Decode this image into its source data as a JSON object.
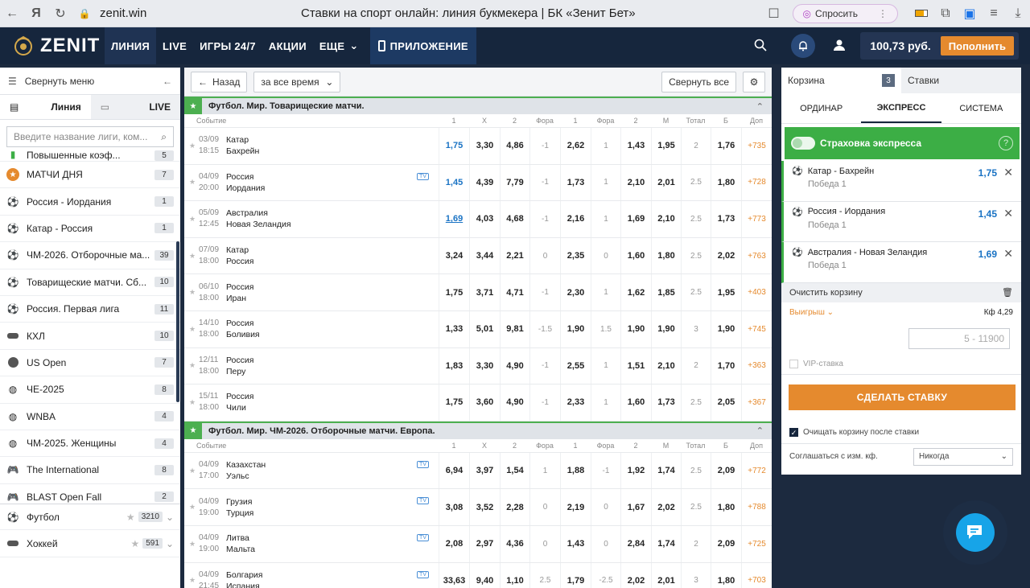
{
  "browser": {
    "url": "zenit.win",
    "title": "Ставки на спорт онлайн: линия букмекера | БК «Зенит Бет»",
    "ask": "Спросить"
  },
  "nav": {
    "logo": "ZENIT",
    "items": [
      "ЛИНИЯ",
      "LIVE",
      "ИГРЫ 24/7",
      "АКЦИИ",
      "ЕЩЕ"
    ],
    "app": "ПРИЛОЖЕНИЕ",
    "balance": "100,73 руб.",
    "deposit": "Пополнить"
  },
  "sidebar": {
    "collapse": "Свернуть меню",
    "tab_line": "Линия",
    "tab_live": "LIVE",
    "search_placeholder": "Введите название лиги, ком...",
    "items": [
      {
        "label": "Повышенные коэф...",
        "count": "5"
      },
      {
        "label": "МАТЧИ ДНЯ",
        "count": "7"
      },
      {
        "label": "Россия - Иордания",
        "count": "1"
      },
      {
        "label": "Катар - Россия",
        "count": "1"
      },
      {
        "label": "ЧМ-2026. Отборочные ма...",
        "count": "39"
      },
      {
        "label": "Товарищеские матчи. Сб...",
        "count": "10"
      },
      {
        "label": "Россия. Первая лига",
        "count": "11"
      },
      {
        "label": "КХЛ",
        "count": "10"
      },
      {
        "label": "US Open",
        "count": "7"
      },
      {
        "label": "ЧЕ-2025",
        "count": "8"
      },
      {
        "label": "WNBA",
        "count": "4"
      },
      {
        "label": "ЧМ-2025. Женщины",
        "count": "4"
      },
      {
        "label": "The International",
        "count": "8"
      },
      {
        "label": "BLAST Open Fall",
        "count": "2"
      },
      {
        "label": "Футбол",
        "count": "3210"
      },
      {
        "label": "Хоккей",
        "count": "591"
      }
    ]
  },
  "main": {
    "back": "Назад",
    "period": "за все время",
    "collapse_all": "Свернуть все",
    "columns": [
      "Событие",
      "1",
      "Х",
      "2",
      "Фора",
      "1",
      "Фора",
      "2",
      "М",
      "Тотал",
      "Б",
      "Доп"
    ],
    "leagues": [
      {
        "title": "Футбол. Мир. Товарищеские матчи.",
        "rows": [
          {
            "date": "03/09",
            "time": "18:15",
            "team1": "Катар",
            "team2": "Бахрейн",
            "tv": false,
            "odds": [
              "1,75",
              "3,30",
              "4,86",
              "-1",
              "2,62",
              "1",
              "1,43",
              "1,95",
              "2",
              "1,76",
              "+735"
            ]
          },
          {
            "date": "04/09",
            "time": "20:00",
            "team1": "Россия",
            "team2": "Иордания",
            "tv": true,
            "odds": [
              "1,45",
              "4,39",
              "7,79",
              "-1",
              "1,73",
              "1",
              "2,10",
              "2,01",
              "2.5",
              "1,80",
              "+728"
            ]
          },
          {
            "date": "05/09",
            "time": "12:45",
            "team1": "Австралия",
            "team2": "Новая Зеландия",
            "tv": false,
            "odds": [
              "1,69",
              "4,03",
              "4,68",
              "-1",
              "2,16",
              "1",
              "1,69",
              "2,10",
              "2.5",
              "1,73",
              "+773"
            ]
          },
          {
            "date": "07/09",
            "time": "18:00",
            "team1": "Катар",
            "team2": "Россия",
            "tv": false,
            "odds": [
              "3,24",
              "3,44",
              "2,21",
              "0",
              "2,35",
              "0",
              "1,60",
              "1,80",
              "2.5",
              "2,02",
              "+763"
            ]
          },
          {
            "date": "06/10",
            "time": "18:00",
            "team1": "Россия",
            "team2": "Иран",
            "tv": false,
            "odds": [
              "1,75",
              "3,71",
              "4,71",
              "-1",
              "2,30",
              "1",
              "1,62",
              "1,85",
              "2.5",
              "1,95",
              "+403"
            ]
          },
          {
            "date": "14/10",
            "time": "18:00",
            "team1": "Россия",
            "team2": "Боливия",
            "tv": false,
            "odds": [
              "1,33",
              "5,01",
              "9,81",
              "-1.5",
              "1,90",
              "1.5",
              "1,90",
              "1,90",
              "3",
              "1,90",
              "+745"
            ]
          },
          {
            "date": "12/11",
            "time": "18:00",
            "team1": "Россия",
            "team2": "Перу",
            "tv": false,
            "odds": [
              "1,83",
              "3,30",
              "4,90",
              "-1",
              "2,55",
              "1",
              "1,51",
              "2,10",
              "2",
              "1,70",
              "+363"
            ]
          },
          {
            "date": "15/11",
            "time": "18:00",
            "team1": "Россия",
            "team2": "Чили",
            "tv": false,
            "odds": [
              "1,75",
              "3,60",
              "4,90",
              "-1",
              "2,33",
              "1",
              "1,60",
              "1,73",
              "2.5",
              "2,05",
              "+367"
            ]
          }
        ]
      },
      {
        "title": "Футбол. Мир. ЧМ-2026. Отборочные матчи. Европа.",
        "rows": [
          {
            "date": "04/09",
            "time": "17:00",
            "team1": "Казахстан",
            "team2": "Уэльс",
            "tv": true,
            "odds": [
              "6,94",
              "3,97",
              "1,54",
              "1",
              "1,88",
              "-1",
              "1,92",
              "1,74",
              "2.5",
              "2,09",
              "+772"
            ]
          },
          {
            "date": "04/09",
            "time": "19:00",
            "team1": "Грузия",
            "team2": "Турция",
            "tv": true,
            "odds": [
              "3,08",
              "3,52",
              "2,28",
              "0",
              "2,19",
              "0",
              "1,67",
              "2,02",
              "2.5",
              "1,80",
              "+788"
            ]
          },
          {
            "date": "04/09",
            "time": "19:00",
            "team1": "Литва",
            "team2": "Мальта",
            "tv": true,
            "odds": [
              "2,08",
              "2,97",
              "4,36",
              "0",
              "1,43",
              "0",
              "2,84",
              "1,74",
              "2",
              "2,09",
              "+725"
            ]
          },
          {
            "date": "04/09",
            "time": "21:45",
            "team1": "Болгария",
            "team2": "Испания",
            "tv": true,
            "odds": [
              "33,63",
              "9,40",
              "1,10",
              "2.5",
              "1,79",
              "-2.5",
              "2,02",
              "2,01",
              "3",
              "1,80",
              "+703"
            ]
          }
        ]
      }
    ]
  },
  "coupon": {
    "tab_basket": "Корзина",
    "basket_count": "3",
    "tab_bets": "Ставки",
    "types": [
      "ОРДИНАР",
      "ЭКСПРЕСС",
      "СИСТЕМА"
    ],
    "insurance": "Страховка экспресса",
    "items": [
      {
        "match": "Катар - Бахрейн",
        "outcome": "Победа 1",
        "odd": "1,75"
      },
      {
        "match": "Россия - Иордания",
        "outcome": "Победа 1",
        "odd": "1,45"
      },
      {
        "match": "Австралия - Новая Зеландия",
        "outcome": "Победа 1",
        "odd": "1,69"
      }
    ],
    "clear": "Очистить корзину",
    "win_label": "Выигрыш",
    "kf": "Кф 4,29",
    "amount_placeholder": "5 - 11900",
    "vip": "VIP-ставка",
    "make_bet": "СДЕЛАТЬ СТАВКУ",
    "clear_after": "Очищать корзину после ставки",
    "agree_label": "Соглашаться с изм. кф.",
    "agree_value": "Никогда"
  },
  "colors": {
    "accent": "#e58a2e",
    "nav": "#16263d",
    "green": "#3cae45",
    "link": "#1a73c4"
  }
}
